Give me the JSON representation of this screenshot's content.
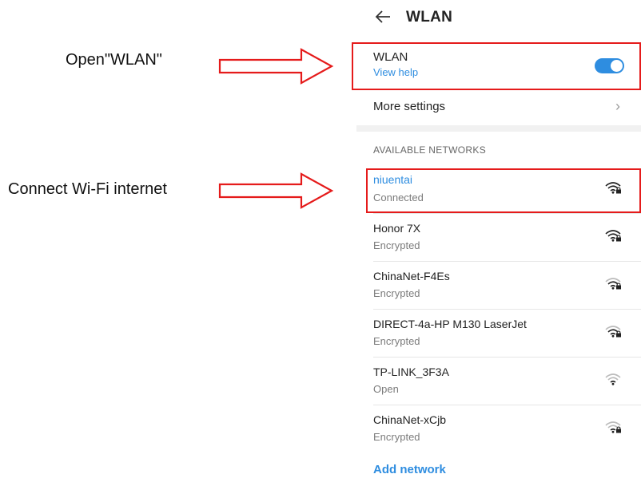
{
  "annotations": {
    "open_wlan": "Open\"WLAN\"",
    "connect_wifi": "Connect Wi-Fi internet"
  },
  "header": {
    "title": "WLAN",
    "back_icon": "arrow-left-icon"
  },
  "wlan_toggle": {
    "label": "WLAN",
    "help_link": "View help",
    "state": "on"
  },
  "more_settings": {
    "label": "More settings"
  },
  "networks_section": {
    "header": "AVAILABLE NETWORKS",
    "networks": [
      {
        "name": "niuentai",
        "status": "Connected",
        "locked": true,
        "connected": true
      },
      {
        "name": "Honor 7X",
        "status": "Encrypted",
        "locked": true,
        "connected": false
      },
      {
        "name": "ChinaNet-F4Es",
        "status": "Encrypted",
        "locked": true,
        "connected": false
      },
      {
        "name": "DIRECT-4a-HP M130 LaserJet",
        "status": "Encrypted",
        "locked": true,
        "connected": false
      },
      {
        "name": "TP-LINK_3F3A",
        "status": "Open",
        "locked": false,
        "connected": false
      },
      {
        "name": "ChinaNet-xCjb",
        "status": "Encrypted",
        "locked": true,
        "connected": false
      }
    ]
  },
  "add_network": {
    "label": "Add network"
  },
  "colors": {
    "accent": "#2e8de0",
    "highlight": "#e51b1b"
  }
}
